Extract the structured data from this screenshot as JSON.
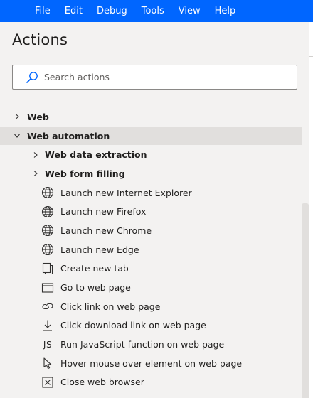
{
  "menubar": {
    "items": [
      "File",
      "Edit",
      "Debug",
      "Tools",
      "View",
      "Help"
    ]
  },
  "panel": {
    "title": "Actions",
    "search": {
      "placeholder": "Search actions",
      "value": ""
    }
  },
  "tree": {
    "web": {
      "label": "Web",
      "expanded": false
    },
    "web_automation": {
      "label": "Web automation",
      "expanded": true,
      "groups": [
        {
          "label": "Web data extraction",
          "expanded": false
        },
        {
          "label": "Web form filling",
          "expanded": false
        }
      ],
      "actions": [
        {
          "label": "Launch new Internet Explorer",
          "icon": "globe-icon"
        },
        {
          "label": "Launch new Firefox",
          "icon": "globe-icon"
        },
        {
          "label": "Launch new Chrome",
          "icon": "globe-icon"
        },
        {
          "label": "Launch new Edge",
          "icon": "globe-icon"
        },
        {
          "label": "Create new tab",
          "icon": "new-tab-icon"
        },
        {
          "label": "Go to web page",
          "icon": "browser-window-icon"
        },
        {
          "label": "Click link on web page",
          "icon": "link-icon"
        },
        {
          "label": "Click download link on web page",
          "icon": "download-icon"
        },
        {
          "label": "Run JavaScript function on web page",
          "icon": "javascript-icon",
          "glyph": "JS"
        },
        {
          "label": "Hover mouse over element on web page",
          "icon": "cursor-icon"
        },
        {
          "label": "Close web browser",
          "icon": "close-browser-icon"
        }
      ]
    }
  },
  "colors": {
    "menubar_bg": "#0066ff",
    "panel_bg": "#f3f2f1",
    "selected_row_bg": "#e1dfdd",
    "search_icon": "#0066ff"
  }
}
